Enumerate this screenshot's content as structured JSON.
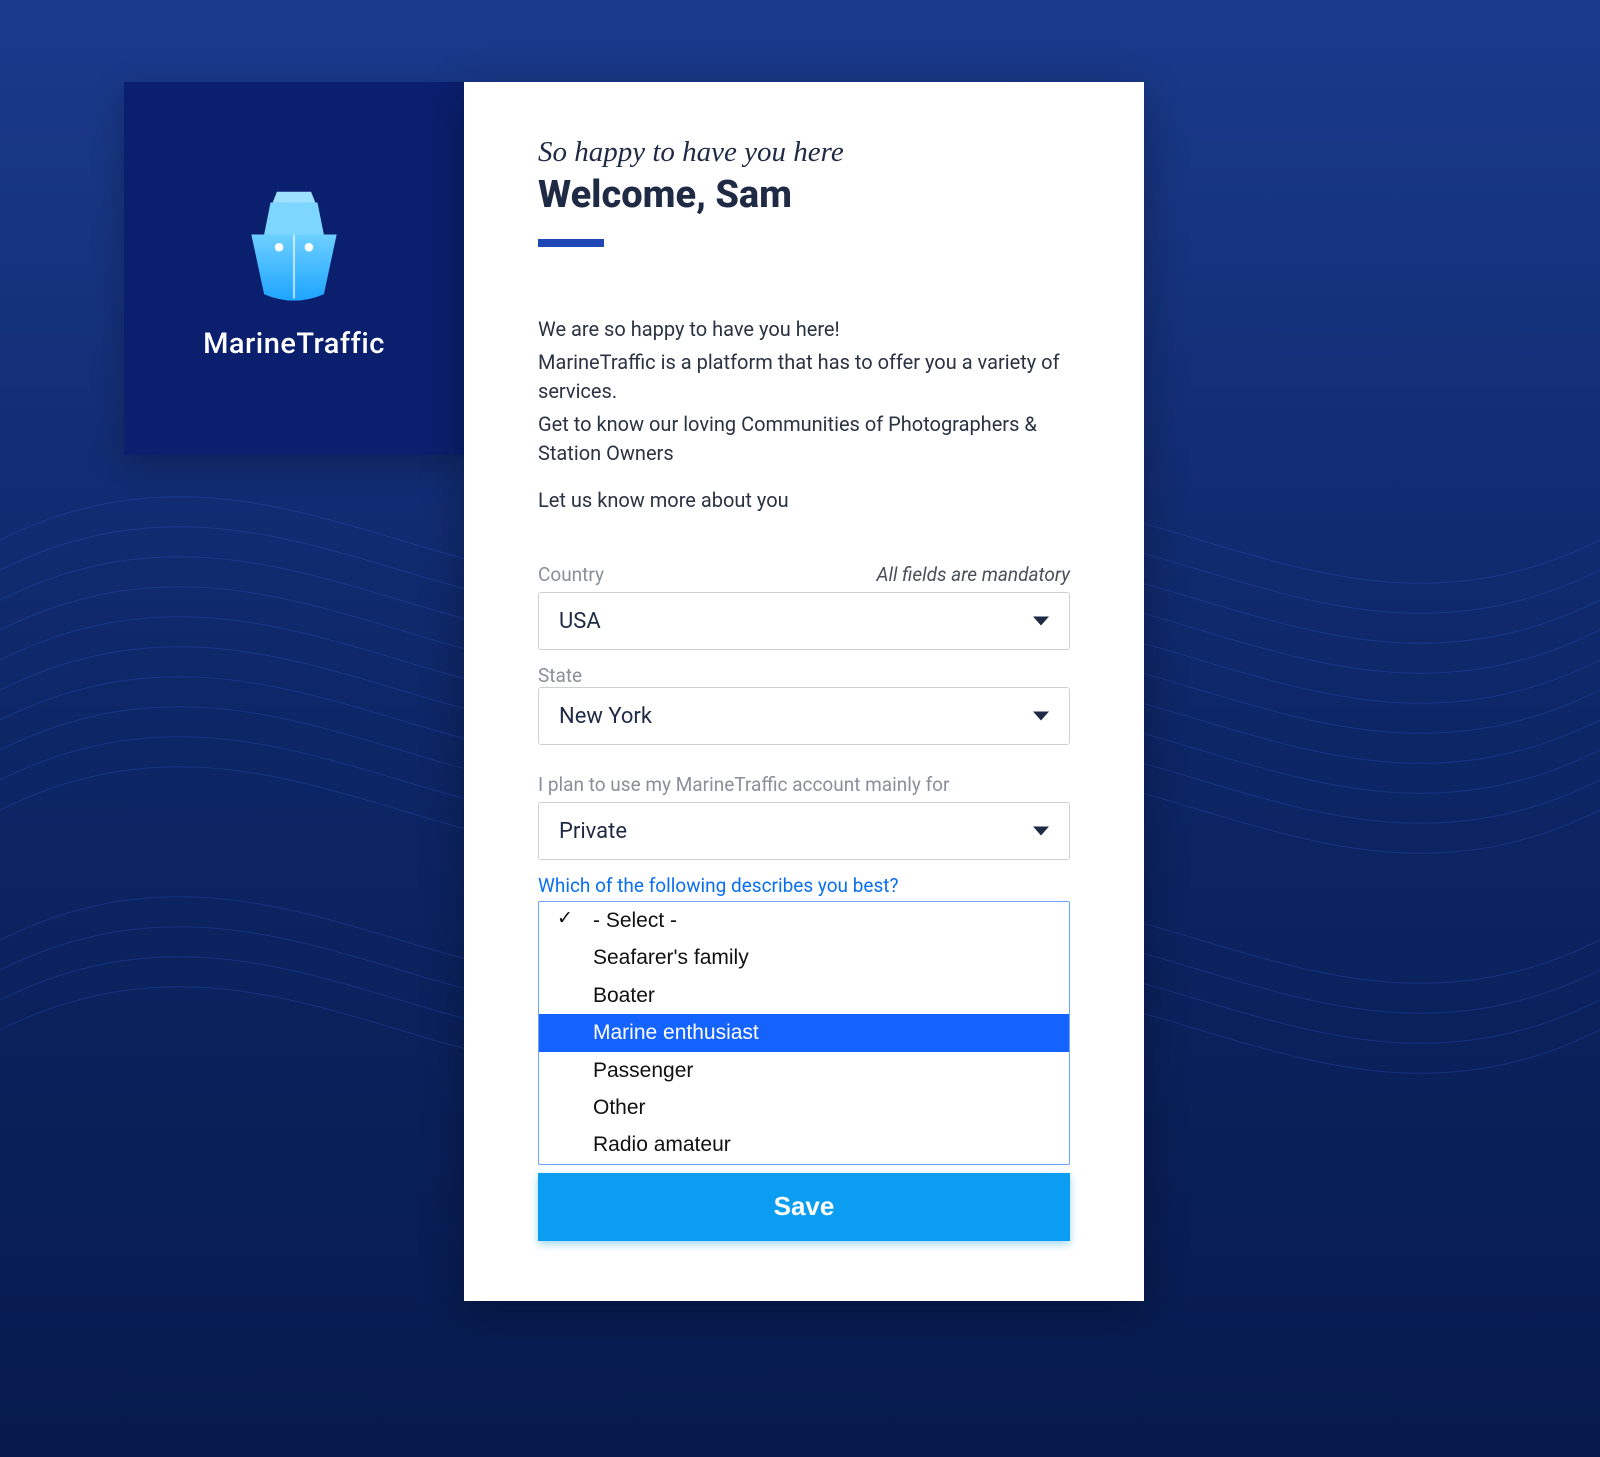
{
  "brand": {
    "name": "MarineTraffic"
  },
  "header": {
    "subtitle": "So happy to have you here",
    "title": "Welcome, Sam"
  },
  "intro": {
    "line1": "We are so happy to have you here!",
    "line2": "MarineTraffic is a platform that has to offer you a variety of services.",
    "line3": "Get to know our loving Communities of Photographers & Station Owners",
    "line4": "Let us know more about you"
  },
  "form": {
    "mandatory_note": "All fields are mandatory",
    "country_label": "Country",
    "country_value": "USA",
    "state_label": "State",
    "state_value": "New York",
    "usage_label": "I plan to use my MarineTraffic account mainly for",
    "usage_value": "Private",
    "describe_label": "Which of the following describes you best?",
    "describe_options": {
      "placeholder": "- Select -",
      "opt1": "Seafarer's family",
      "opt2": "Boater",
      "opt3": "Marine enthusiast",
      "opt4": "Passenger",
      "opt5": "Other",
      "opt6": "Radio amateur"
    },
    "save_label": "Save"
  }
}
